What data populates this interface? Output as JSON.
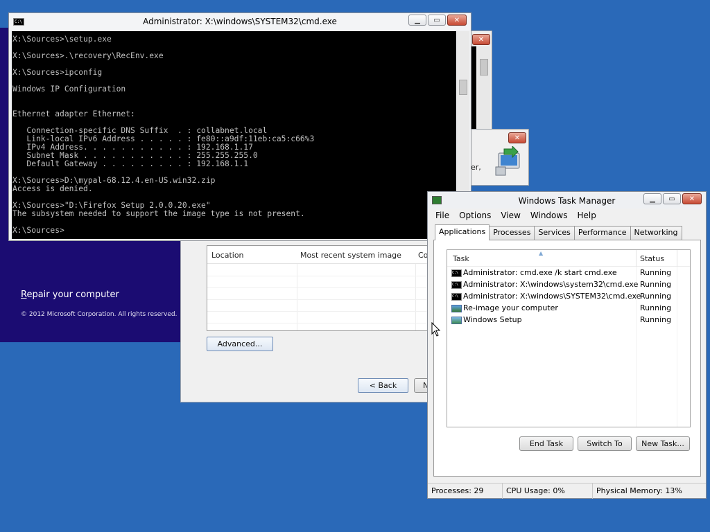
{
  "recovery": {
    "repair_label_first": "R",
    "repair_label_rest": "epair your computer",
    "copyright": "© 2012 Microsoft Corporation. All rights reserved."
  },
  "system_image_dialog": {
    "columns": [
      "Location",
      "Most recent system image",
      "Co"
    ],
    "advanced_button": "Advanced...",
    "back_button": "< Back",
    "next_button_partial": "N"
  },
  "reimage_dialog": {
    "partial_text": "er,"
  },
  "cmd": {
    "title": "Administrator: X:\\windows\\SYSTEM32\\cmd.exe",
    "icon_text": "C:\\",
    "lines": [
      "X:\\Sources>\\setup.exe",
      "",
      "X:\\Sources>.\\recovery\\RecEnv.exe",
      "",
      "X:\\Sources>ipconfig",
      "",
      "Windows IP Configuration",
      "",
      "",
      "Ethernet adapter Ethernet:",
      "",
      "   Connection-specific DNS Suffix  . : collabnet.local",
      "   Link-local IPv6 Address . . . . . : fe80::a9df:11eb:ca5:c66%3",
      "   IPv4 Address. . . . . . . . . . . : 192.168.1.17",
      "   Subnet Mask . . . . . . . . . . . : 255.255.255.0",
      "   Default Gateway . . . . . . . . . : 192.168.1.1",
      "",
      "X:\\Sources>D:\\mypal-68.12.4.en-US.win32.zip",
      "Access is denied.",
      "",
      "X:\\Sources>\"D:\\Firefox Setup 2.0.0.20.exe\"",
      "The subsystem needed to support the image type is not present.",
      "",
      "X:\\Sources>"
    ]
  },
  "taskmgr": {
    "title": "Windows Task Manager",
    "menu": [
      "File",
      "Options",
      "View",
      "Windows",
      "Help"
    ],
    "tabs": [
      "Applications",
      "Processes",
      "Services",
      "Performance",
      "Networking"
    ],
    "active_tab": "Applications",
    "columns": {
      "task": "Task",
      "status": "Status"
    },
    "tasks": [
      {
        "name": "Administrator: cmd.exe /k start cmd.exe",
        "status": "Running",
        "icon": "cmd-icon"
      },
      {
        "name": "Administrator: X:\\windows\\system32\\cmd.exe",
        "status": "Running",
        "icon": "cmd-icon"
      },
      {
        "name": "Administrator: X:\\windows\\SYSTEM32\\cmd.exe",
        "status": "Running",
        "icon": "cmd-icon"
      },
      {
        "name": "Re-image your computer",
        "status": "Running",
        "icon": "reimage-icon"
      },
      {
        "name": "Windows Setup",
        "status": "Running",
        "icon": "setup-icon"
      }
    ],
    "buttons": {
      "end_task": "End Task",
      "switch_to": "Switch To",
      "new_task": "New Task..."
    },
    "status": {
      "processes": "Processes: 29",
      "cpu": "CPU Usage: 0%",
      "memory": "Physical Memory: 13%"
    }
  },
  "colors": {
    "desktop": "#2a69b8",
    "recovery_bg": "#1b0c72",
    "console_bg": "#000000",
    "console_text": "#c0c0c0"
  }
}
